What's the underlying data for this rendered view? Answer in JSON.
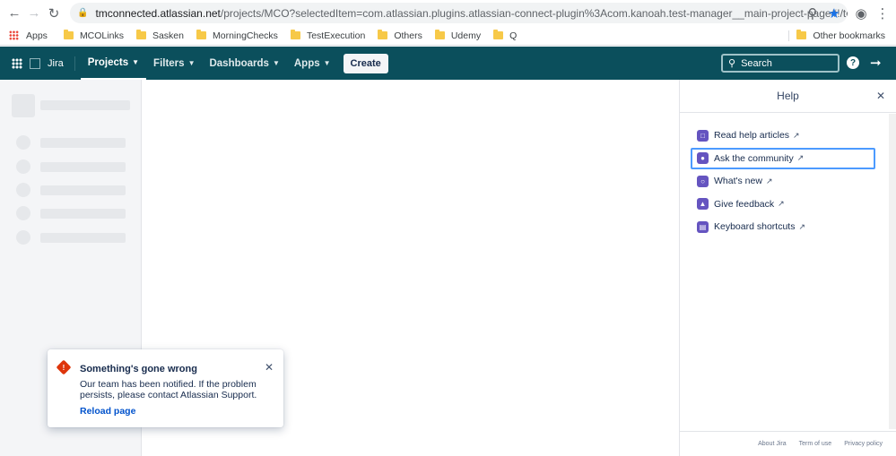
{
  "browser": {
    "url_host": "tmconnected.atlassian.net",
    "url_path": "/projects/MCO?selectedItem=com.atlassian.plugins.atlassian-connect-plugin%3Acom.kanoah.test-manager__main-project-page#!/testPlayer/FM-R...",
    "bookmarks": [
      "Apps",
      "MCOLinks",
      "Sasken",
      "MorningChecks",
      "TestExecution",
      "Others",
      "Udemy",
      "Q"
    ],
    "other_bookmarks": "Other bookmarks"
  },
  "jira_nav": {
    "product": "Jira",
    "items": [
      "Projects",
      "Filters",
      "Dashboards",
      "Apps"
    ],
    "create_label": "Create",
    "search_label": "Search"
  },
  "help": {
    "title": "Help",
    "items": [
      "Read help articles",
      "Ask the community",
      "What's new",
      "Give feedback",
      "Keyboard shortcuts"
    ],
    "footer": [
      "About Jira",
      "Term of use",
      "Privacy policy"
    ]
  },
  "error_flag": {
    "title": "Something's gone wrong",
    "body": "Our team has been notified. If the problem persists, please contact Atlassian Support.",
    "link": "Reload page"
  },
  "colors": {
    "nav_bg": "#0b4f5c",
    "error": "#de350b",
    "help_icon": "#6554c0",
    "link": "#0052cc",
    "focus": "#4c9aff"
  }
}
